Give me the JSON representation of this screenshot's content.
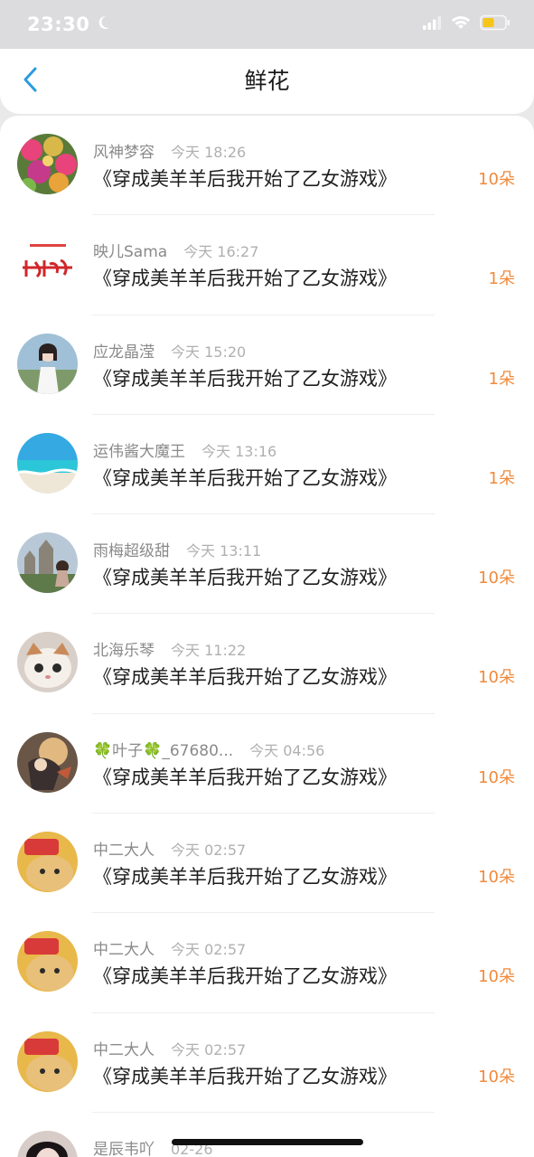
{
  "status_bar": {
    "time": "23:30"
  },
  "nav": {
    "title": "鲜花"
  },
  "items": [
    {
      "user": "风神梦容",
      "time": "今天 18:26",
      "book": "《穿成美羊羊后我开始了乙女游戏》",
      "count": "10朵",
      "avatar": "flowers-avatar"
    },
    {
      "user": "映儿Sama",
      "time": "今天 16:27",
      "book": "《穿成美羊羊后我开始了乙女游戏》",
      "count": "1朵",
      "avatar": "handwriting-logo-avatar"
    },
    {
      "user": "应龙晶滢",
      "time": "今天 15:20",
      "book": "《穿成美羊羊后我开始了乙女游戏》",
      "count": "1朵",
      "avatar": "girl-photo-avatar"
    },
    {
      "user": "运伟酱大魔王",
      "time": "今天 13:16",
      "book": "《穿成美羊羊后我开始了乙女游戏》",
      "count": "1朵",
      "avatar": "beach-avatar"
    },
    {
      "user": "雨梅超级甜",
      "time": "今天 13:11",
      "book": "《穿成美羊羊后我开始了乙女游戏》",
      "count": "10朵",
      "avatar": "castle-avatar"
    },
    {
      "user": "北海乐琴",
      "time": "今天 11:22",
      "book": "《穿成美羊羊后我开始了乙女游戏》",
      "count": "10朵",
      "avatar": "cat-avatar"
    },
    {
      "user": "🍀叶子🍀_67680...",
      "time": "今天 04:56",
      "book": "《穿成美羊羊后我开始了乙女游戏》",
      "count": "10朵",
      "avatar": "anime-art-avatar"
    },
    {
      "user": "中二大人",
      "time": "今天 02:57",
      "book": "《穿成美羊羊后我开始了乙女游戏》",
      "count": "10朵",
      "avatar": "cat-chips-avatar"
    },
    {
      "user": "中二大人",
      "time": "今天 02:57",
      "book": "《穿成美羊羊后我开始了乙女游戏》",
      "count": "10朵",
      "avatar": "cat-chips-avatar"
    },
    {
      "user": "中二大人",
      "time": "今天 02:57",
      "book": "《穿成美羊羊后我开始了乙女游戏》",
      "count": "10朵",
      "avatar": "cat-chips-avatar"
    },
    {
      "user": "是辰韦吖",
      "time": "02-26",
      "book": "",
      "count": "",
      "avatar": "dark-hair-avatar"
    }
  ],
  "colors": {
    "accent_orange": "#f08a3c",
    "back_blue": "#2b9ce0"
  }
}
